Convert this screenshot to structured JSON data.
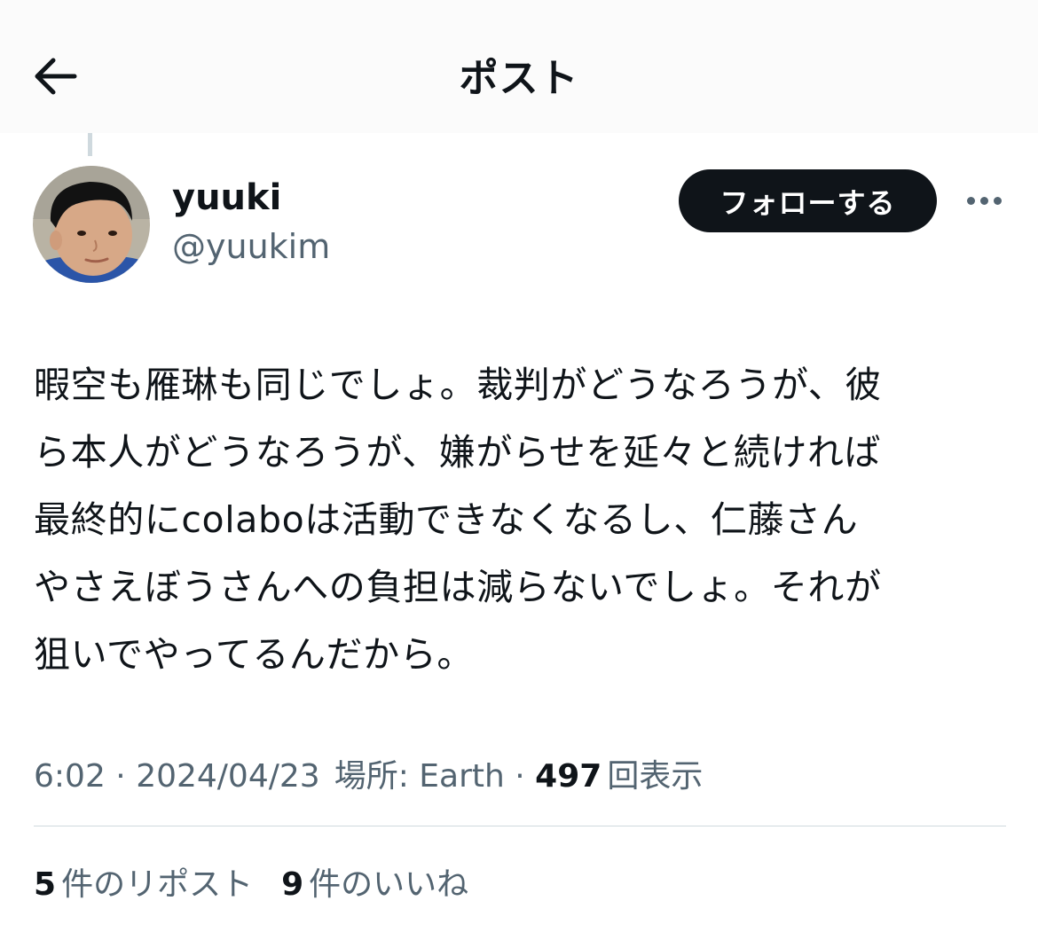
{
  "header": {
    "title": "ポスト",
    "back_icon": "arrow-left-icon"
  },
  "author": {
    "display_name": "yuuki",
    "handle": "@yuukim",
    "follow_label": "フォローする",
    "more_icon": "ellipsis-icon"
  },
  "post": {
    "lines": [
      "暇空も雁琳も同じでしょ。裁判がどうなろうが、彼",
      "ら本人がどうなろうが、嫌がらせを延々と続ければ",
      "最終的にcolaboは活動できなくなるし、仁藤さん",
      "やさえぼうさんへの負担は減らないでしょ。それが",
      "狙いでやってるんだから。"
    ]
  },
  "meta": {
    "time": "6:02",
    "sep1": " · ",
    "date": "2024/04/23",
    "location_label": "場所: Earth",
    "sep2": " · ",
    "views_count": "497",
    "views_label": "回表示"
  },
  "stats": {
    "reposts_count": "5",
    "reposts_label": "件のリポスト",
    "likes_count": "9",
    "likes_label": "件のいいね"
  },
  "colors": {
    "text": "#0f1419",
    "secondary": "#536471",
    "divider": "#cfd9de"
  }
}
